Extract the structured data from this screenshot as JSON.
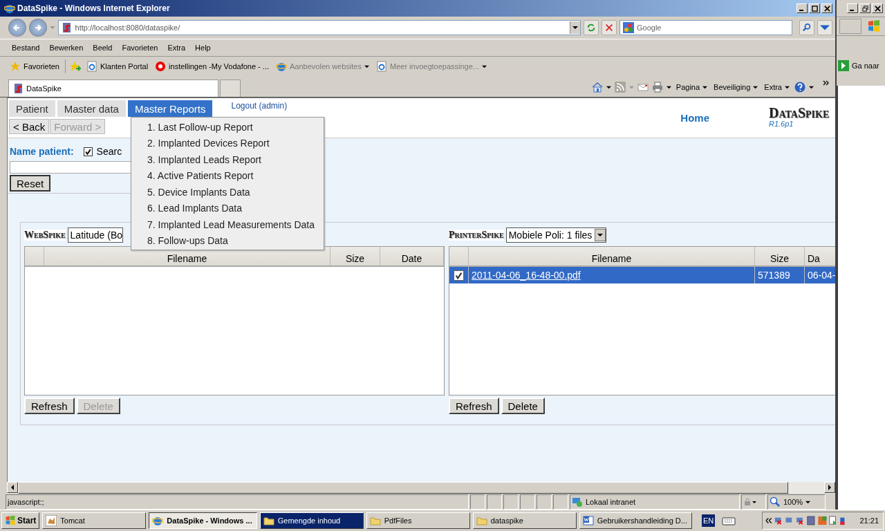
{
  "browser": {
    "title": "DataSpike - Windows Internet Explorer",
    "address": "http://localhost:8080/dataspike/",
    "search_placeholder": "Google",
    "menu": [
      "Bestand",
      "Bewerken",
      "Beeld",
      "Favorieten",
      "Extra",
      "Help"
    ],
    "favorites_button": "Favorieten",
    "favorites": [
      {
        "label": "Klanten Portal",
        "kind": "page"
      },
      {
        "label": "instellingen -My Vodafone - ...",
        "kind": "dot"
      },
      {
        "label": "Aanbevolen websites",
        "kind": "globemenu"
      },
      {
        "label": "Meer invoegtoepassinge...",
        "kind": "pagemenu"
      }
    ],
    "tab": "DataSpike",
    "commands": [
      "Pagina",
      "Beveiliging",
      "Extra"
    ],
    "status": "javascript:;",
    "zone": "Lokaal intranet",
    "zoom": "100%"
  },
  "app": {
    "nav": [
      {
        "label": "Patient",
        "selected": false
      },
      {
        "label": "Master data",
        "selected": false
      },
      {
        "label": "Master Reports",
        "selected": true
      }
    ],
    "logout": "Logout (admin)",
    "home": "Home",
    "logo": "DataSpike",
    "version": "R1.6p1",
    "history": [
      {
        "label": "< Back",
        "disabled": false
      },
      {
        "label": "Forward >",
        "disabled": true
      }
    ],
    "menu_items": [
      "1. Last Follow-up Report",
      "2. Implanted Devices Report",
      "3. Implanted Leads Report",
      "4. Active Patients Report",
      "5. Device Implants Data",
      "6. Lead Implants Data",
      "7. Implanted Lead Measurements Data",
      "8. Follow-ups Data"
    ],
    "search": {
      "label": "Name patient:",
      "checked": true,
      "option": "Searc"
    },
    "reset": "Reset",
    "panels": [
      {
        "logo": "WebSpike",
        "source": "Latitude (Bo",
        "arrow": false,
        "columns": [
          "Filename",
          "Size",
          "Date"
        ],
        "buttons": [
          {
            "label": "Refresh",
            "disabled": false
          },
          {
            "label": "Delete",
            "disabled": true
          }
        ]
      },
      {
        "logo": "PrinterSpike",
        "source": "Mobiele Poli: 1 files",
        "arrow": true,
        "columns": [
          "Filename",
          "Size",
          "Da"
        ],
        "rows": [
          {
            "checked": true,
            "selected": true,
            "filename": "2011-04-06_16-48-00.pdf",
            "size": "571389",
            "date": "06-04-"
          }
        ],
        "buttons": [
          {
            "label": "Refresh",
            "disabled": false
          },
          {
            "label": "Delete",
            "disabled": false
          }
        ]
      }
    ]
  },
  "background_window": {
    "go": "Ga naar"
  },
  "taskbar": {
    "start": "Start",
    "items": [
      {
        "label": "Tomcat",
        "kind": "app",
        "selected": false,
        "flashing": false
      },
      {
        "label": "DataSpike - Windows ...",
        "kind": "browser",
        "selected": true,
        "flashing": false
      },
      {
        "label": "Gemengde inhoud",
        "kind": "folder",
        "selected": false,
        "flashing": true
      },
      {
        "label": "PdfFiles",
        "kind": "folder",
        "selected": false,
        "flashing": false
      },
      {
        "label": "dataspike",
        "kind": "folder",
        "selected": false,
        "flashing": false
      },
      {
        "label": "Gebruikershandleiding D...",
        "kind": "word",
        "selected": false,
        "flashing": false
      }
    ],
    "language": "EN",
    "clock": "21:21"
  }
}
